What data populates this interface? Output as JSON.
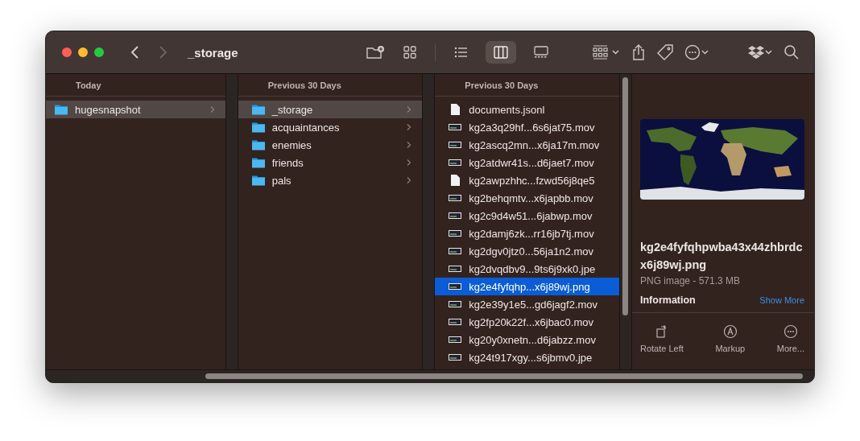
{
  "window": {
    "title": "_storage"
  },
  "toolbar": {
    "views": [
      {
        "kind": "icons",
        "selected": false
      },
      {
        "kind": "list",
        "selected": false
      },
      {
        "kind": "columns",
        "selected": true
      },
      {
        "kind": "gallery",
        "selected": false
      }
    ]
  },
  "columns": [
    {
      "heading": "Today",
      "focused": false,
      "items": [
        {
          "name": "hugesnapshot",
          "kind": "folder",
          "selected": true
        }
      ]
    },
    {
      "heading": "Previous 30 Days",
      "focused": false,
      "items": [
        {
          "name": "_storage",
          "kind": "folder",
          "selected": true
        },
        {
          "name": "acquaintances",
          "kind": "folder",
          "selected": false
        },
        {
          "name": "enemies",
          "kind": "folder",
          "selected": false
        },
        {
          "name": "friends",
          "kind": "folder",
          "selected": false
        },
        {
          "name": "pals",
          "kind": "folder",
          "selected": false
        }
      ]
    },
    {
      "heading": "Previous 30 Days",
      "focused": true,
      "items": [
        {
          "name": "documents.jsonl",
          "kind": "document",
          "selected": false
        },
        {
          "name": "kg2a3q29hf...6s6jat75.mov",
          "kind": "thumbnail",
          "selected": false
        },
        {
          "name": "kg2ascq2mn...x6ja17m.mov",
          "kind": "thumbnail",
          "selected": false
        },
        {
          "name": "kg2atdwr41s...d6jaet7.mov",
          "kind": "thumbnail",
          "selected": false
        },
        {
          "name": "kg2awpzhhc...fzwd56j8qe5",
          "kind": "document",
          "selected": false
        },
        {
          "name": "kg2behqmtv...x6japbb.mov",
          "kind": "thumbnail",
          "selected": false
        },
        {
          "name": "kg2c9d4w51...6jabwp.mov",
          "kind": "thumbnail",
          "selected": false
        },
        {
          "name": "kg2damj6zk...rr16jb7tj.mov",
          "kind": "thumbnail",
          "selected": false
        },
        {
          "name": "kg2dgv0jtz0...56ja1n2.mov",
          "kind": "thumbnail",
          "selected": false
        },
        {
          "name": "kg2dvqdbv9...9ts6j9xk0.jpe",
          "kind": "thumbnail",
          "selected": false
        },
        {
          "name": "kg2e4fyfqhp...x6j89wj.png",
          "kind": "thumbnail",
          "selected": true
        },
        {
          "name": "kg2e39y1e5...gd6jagf2.mov",
          "kind": "thumbnail",
          "selected": false
        },
        {
          "name": "kg2fp20k22f...x6jbac0.mov",
          "kind": "thumbnail",
          "selected": false
        },
        {
          "name": "kg20y0xnetn...d6jabzz.mov",
          "kind": "thumbnail",
          "selected": false
        },
        {
          "name": "kg24t917xgy...s6jbmv0.jpe",
          "kind": "thumbnail",
          "selected": false
        }
      ]
    }
  ],
  "preview": {
    "filename": "kg2e4fyfqhpwba43x44zhbrdcx6j89wj.png",
    "info": "PNG image - 571.3 MB",
    "section": "Information",
    "show_more": "Show More",
    "actions": [
      {
        "kind": "rotate",
        "label": "Rotate Left"
      },
      {
        "kind": "markup",
        "label": "Markup"
      },
      {
        "kind": "more",
        "label": "More..."
      }
    ]
  }
}
